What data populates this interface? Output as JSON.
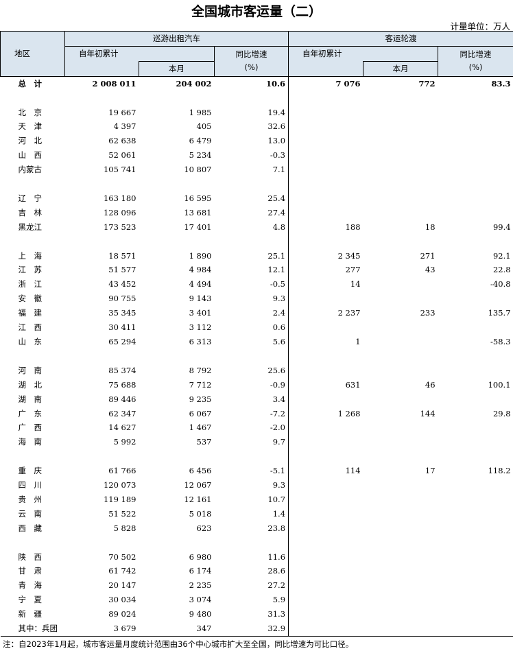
{
  "title": "全国城市客运量（二）",
  "unit": "计量单位：万人",
  "headers": {
    "region": "地区",
    "group1": "巡游出租汽车",
    "group2": "客运轮渡",
    "ytd": "自年初累计",
    "month": "本月",
    "yoy": "同比增速",
    "yoy_unit": "(%)"
  },
  "total": {
    "region": "总　计",
    "taxi_ytd": "2 008 011",
    "taxi_month": "204 002",
    "taxi_yoy": "10.6",
    "ferry_ytd": "7 076",
    "ferry_month": "772",
    "ferry_yoy": "83.3"
  },
  "groups": [
    [
      {
        "region": "北　京",
        "taxi_ytd": "19 667",
        "taxi_month": "1 985",
        "taxi_yoy": "19.4",
        "ferry_ytd": "",
        "ferry_month": "",
        "ferry_yoy": ""
      },
      {
        "region": "天　津",
        "taxi_ytd": "4 397",
        "taxi_month": "405",
        "taxi_yoy": "32.6",
        "ferry_ytd": "",
        "ferry_month": "",
        "ferry_yoy": ""
      },
      {
        "region": "河　北",
        "taxi_ytd": "62 638",
        "taxi_month": "6 479",
        "taxi_yoy": "13.0",
        "ferry_ytd": "",
        "ferry_month": "",
        "ferry_yoy": ""
      },
      {
        "region": "山　西",
        "taxi_ytd": "52 061",
        "taxi_month": "5 234",
        "taxi_yoy": "-0.3",
        "ferry_ytd": "",
        "ferry_month": "",
        "ferry_yoy": ""
      },
      {
        "region": "内蒙古",
        "taxi_ytd": "105 741",
        "taxi_month": "10 807",
        "taxi_yoy": "7.1",
        "ferry_ytd": "",
        "ferry_month": "",
        "ferry_yoy": ""
      }
    ],
    [
      {
        "region": "辽　宁",
        "taxi_ytd": "163 180",
        "taxi_month": "16 595",
        "taxi_yoy": "25.4",
        "ferry_ytd": "",
        "ferry_month": "",
        "ferry_yoy": ""
      },
      {
        "region": "吉　林",
        "taxi_ytd": "128 096",
        "taxi_month": "13 681",
        "taxi_yoy": "27.4",
        "ferry_ytd": "",
        "ferry_month": "",
        "ferry_yoy": ""
      },
      {
        "region": "黑龙江",
        "taxi_ytd": "173 523",
        "taxi_month": "17 401",
        "taxi_yoy": "4.8",
        "ferry_ytd": "188",
        "ferry_month": "18",
        "ferry_yoy": "99.4"
      }
    ],
    [
      {
        "region": "上　海",
        "taxi_ytd": "18 571",
        "taxi_month": "1 890",
        "taxi_yoy": "25.1",
        "ferry_ytd": "2 345",
        "ferry_month": "271",
        "ferry_yoy": "92.1"
      },
      {
        "region": "江　苏",
        "taxi_ytd": "51 577",
        "taxi_month": "4 984",
        "taxi_yoy": "12.1",
        "ferry_ytd": "277",
        "ferry_month": "43",
        "ferry_yoy": "22.8"
      },
      {
        "region": "浙　江",
        "taxi_ytd": "43 452",
        "taxi_month": "4 494",
        "taxi_yoy": "-0.5",
        "ferry_ytd": "14",
        "ferry_month": "",
        "ferry_yoy": "-40.8"
      },
      {
        "region": "安　徽",
        "taxi_ytd": "90 755",
        "taxi_month": "9 143",
        "taxi_yoy": "9.3",
        "ferry_ytd": "",
        "ferry_month": "",
        "ferry_yoy": ""
      },
      {
        "region": "福　建",
        "taxi_ytd": "35 345",
        "taxi_month": "3 401",
        "taxi_yoy": "2.4",
        "ferry_ytd": "2 237",
        "ferry_month": "233",
        "ferry_yoy": "135.7"
      },
      {
        "region": "江　西",
        "taxi_ytd": "30 411",
        "taxi_month": "3 112",
        "taxi_yoy": "0.6",
        "ferry_ytd": "",
        "ferry_month": "",
        "ferry_yoy": ""
      },
      {
        "region": "山　东",
        "taxi_ytd": "65 294",
        "taxi_month": "6 313",
        "taxi_yoy": "5.6",
        "ferry_ytd": "1",
        "ferry_month": "",
        "ferry_yoy": "-58.3"
      }
    ],
    [
      {
        "region": "河　南",
        "taxi_ytd": "85 374",
        "taxi_month": "8 792",
        "taxi_yoy": "25.6",
        "ferry_ytd": "",
        "ferry_month": "",
        "ferry_yoy": ""
      },
      {
        "region": "湖　北",
        "taxi_ytd": "75 688",
        "taxi_month": "7 712",
        "taxi_yoy": "-0.9",
        "ferry_ytd": "631",
        "ferry_month": "46",
        "ferry_yoy": "100.1"
      },
      {
        "region": "湖　南",
        "taxi_ytd": "89 446",
        "taxi_month": "9 235",
        "taxi_yoy": "3.4",
        "ferry_ytd": "",
        "ferry_month": "",
        "ferry_yoy": ""
      },
      {
        "region": "广　东",
        "taxi_ytd": "62 347",
        "taxi_month": "6 067",
        "taxi_yoy": "-7.2",
        "ferry_ytd": "1 268",
        "ferry_month": "144",
        "ferry_yoy": "29.8"
      },
      {
        "region": "广　西",
        "taxi_ytd": "14 627",
        "taxi_month": "1 467",
        "taxi_yoy": "-2.0",
        "ferry_ytd": "",
        "ferry_month": "",
        "ferry_yoy": ""
      },
      {
        "region": "海　南",
        "taxi_ytd": "5 992",
        "taxi_month": "537",
        "taxi_yoy": "9.7",
        "ferry_ytd": "",
        "ferry_month": "",
        "ferry_yoy": ""
      }
    ],
    [
      {
        "region": "重　庆",
        "taxi_ytd": "61 766",
        "taxi_month": "6 456",
        "taxi_yoy": "-5.1",
        "ferry_ytd": "114",
        "ferry_month": "17",
        "ferry_yoy": "118.2"
      },
      {
        "region": "四　川",
        "taxi_ytd": "120 073",
        "taxi_month": "12 067",
        "taxi_yoy": "9.3",
        "ferry_ytd": "",
        "ferry_month": "",
        "ferry_yoy": ""
      },
      {
        "region": "贵　州",
        "taxi_ytd": "119 189",
        "taxi_month": "12 161",
        "taxi_yoy": "10.7",
        "ferry_ytd": "",
        "ferry_month": "",
        "ferry_yoy": ""
      },
      {
        "region": "云　南",
        "taxi_ytd": "51 522",
        "taxi_month": "5 018",
        "taxi_yoy": "1.4",
        "ferry_ytd": "",
        "ferry_month": "",
        "ferry_yoy": ""
      },
      {
        "region": "西　藏",
        "taxi_ytd": "5 828",
        "taxi_month": "623",
        "taxi_yoy": "23.8",
        "ferry_ytd": "",
        "ferry_month": "",
        "ferry_yoy": ""
      }
    ],
    [
      {
        "region": "陕　西",
        "taxi_ytd": "70 502",
        "taxi_month": "6 980",
        "taxi_yoy": "11.6",
        "ferry_ytd": "",
        "ferry_month": "",
        "ferry_yoy": ""
      },
      {
        "region": "甘　肃",
        "taxi_ytd": "61 742",
        "taxi_month": "6 174",
        "taxi_yoy": "28.6",
        "ferry_ytd": "",
        "ferry_month": "",
        "ferry_yoy": ""
      },
      {
        "region": "青　海",
        "taxi_ytd": "20 147",
        "taxi_month": "2 235",
        "taxi_yoy": "27.2",
        "ferry_ytd": "",
        "ferry_month": "",
        "ferry_yoy": ""
      },
      {
        "region": "宁　夏",
        "taxi_ytd": "30 034",
        "taxi_month": "3 074",
        "taxi_yoy": "5.9",
        "ferry_ytd": "",
        "ferry_month": "",
        "ferry_yoy": ""
      },
      {
        "region": "新　疆",
        "taxi_ytd": "89 024",
        "taxi_month": "9 480",
        "taxi_yoy": "31.3",
        "ferry_ytd": "",
        "ferry_month": "",
        "ferry_yoy": ""
      },
      {
        "region": "其中：兵团",
        "taxi_ytd": "3 679",
        "taxi_month": "347",
        "taxi_yoy": "32.9",
        "ferry_ytd": "",
        "ferry_month": "",
        "ferry_yoy": ""
      }
    ]
  ],
  "note": "注：自2023年1月起，城市客运量月度统计范围由36个中心城市扩大至全国，同比增速为可比口径。"
}
